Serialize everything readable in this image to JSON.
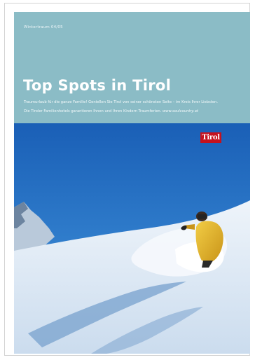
{
  "brochure": {
    "edition": "Wintertraum 04/05",
    "title": "Top Spots in Tirol",
    "intro_line1": "Traumurlaub für die ganze Familie! Genießen Sie Tirol von seiner schönsten Seite – im Kreis Ihrer Liebsten.",
    "intro_line2": "Die Tiroler Familienhotels garantieren Ihnen und Ihren Kindern Traumferien.",
    "url": "www.soulcountry.at"
  },
  "logo": {
    "text": "Tirol",
    "color": "#c4121e"
  },
  "colors": {
    "header_band": "#8bbcc6",
    "sky": "#1e63ba",
    "snow": "#dfe9f4",
    "jacket": "#e3b62a"
  }
}
